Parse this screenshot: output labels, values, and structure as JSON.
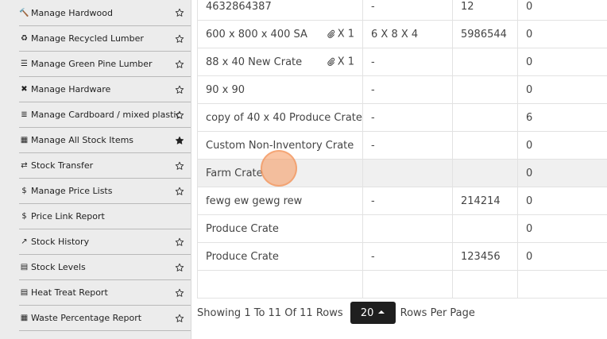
{
  "sidebar": {
    "items": [
      {
        "label": "Manage Hardwood",
        "icon": "hammer-icon",
        "glyph": "🔨",
        "starred": false
      },
      {
        "label": "Manage Recycled Lumber",
        "icon": "recycle-icon",
        "glyph": "♻",
        "starred": false
      },
      {
        "label": "Manage Green Pine Lumber",
        "icon": "lumber-stack-icon",
        "glyph": "☰",
        "starred": false
      },
      {
        "label": "Manage Hardware",
        "icon": "tools-icon",
        "glyph": "✖",
        "starred": false
      },
      {
        "label": "Manage Cardboard / mixed plastic",
        "icon": "list-icon",
        "glyph": "≣",
        "starred": false
      },
      {
        "label": "Manage All Stock Items",
        "icon": "warehouse-icon",
        "glyph": "▦",
        "starred": true
      },
      {
        "label": "Stock Transfer",
        "icon": "shuffle-icon",
        "glyph": "⇄",
        "starred": false
      },
      {
        "label": "Manage Price Lists",
        "icon": "dollar-icon",
        "glyph": "$",
        "starred": false
      },
      {
        "label": "Price Link Report",
        "icon": "dollar-icon",
        "glyph": "$",
        "starred": null
      },
      {
        "label": "Stock History",
        "icon": "line-chart-icon",
        "glyph": "↗",
        "starred": false
      },
      {
        "label": "Stock Levels",
        "icon": "file-icon",
        "glyph": "▤",
        "starred": false
      },
      {
        "label": "Heat Treat Report",
        "icon": "file-icon",
        "glyph": "▤",
        "starred": false
      },
      {
        "label": "Waste Percentage Report",
        "icon": "table-icon",
        "glyph": "▦",
        "starred": false
      }
    ]
  },
  "table": {
    "rows": [
      {
        "name": "4632864387",
        "attach": "",
        "size": "-",
        "code": "12",
        "qty": "0"
      },
      {
        "name": "600 x 800 x 400 SA",
        "attach": "X 1",
        "size": "6 X 8 X 4",
        "code": "5986544",
        "qty": "0"
      },
      {
        "name": "88 x 40 New Crate",
        "attach": "X 1",
        "size": "-",
        "code": "",
        "qty": "0"
      },
      {
        "name": "90 x 90",
        "attach": "",
        "size": "-",
        "code": "",
        "qty": "0"
      },
      {
        "name": "copy of 40 x 40 Produce Crate",
        "attach": "",
        "size": "-",
        "code": "",
        "qty": "6"
      },
      {
        "name": "Custom Non-Inventory Crate",
        "attach": "",
        "size": "-",
        "code": "",
        "qty": "0"
      },
      {
        "name": "Farm Crate",
        "attach": "",
        "size": "",
        "code": "",
        "qty": "0"
      },
      {
        "name": "fewg ew gewg rew",
        "attach": "",
        "size": "-",
        "code": "214214",
        "qty": "0"
      },
      {
        "name": "Produce Crate",
        "attach": "",
        "size": "",
        "code": "",
        "qty": "0"
      },
      {
        "name": "Produce Crate",
        "attach": "",
        "size": "-",
        "code": "123456",
        "qty": "0"
      }
    ]
  },
  "pagination": {
    "summary": "Showing 1 To 11 Of 11 Rows",
    "page_size": "20",
    "suffix": "Rows Per Page"
  }
}
